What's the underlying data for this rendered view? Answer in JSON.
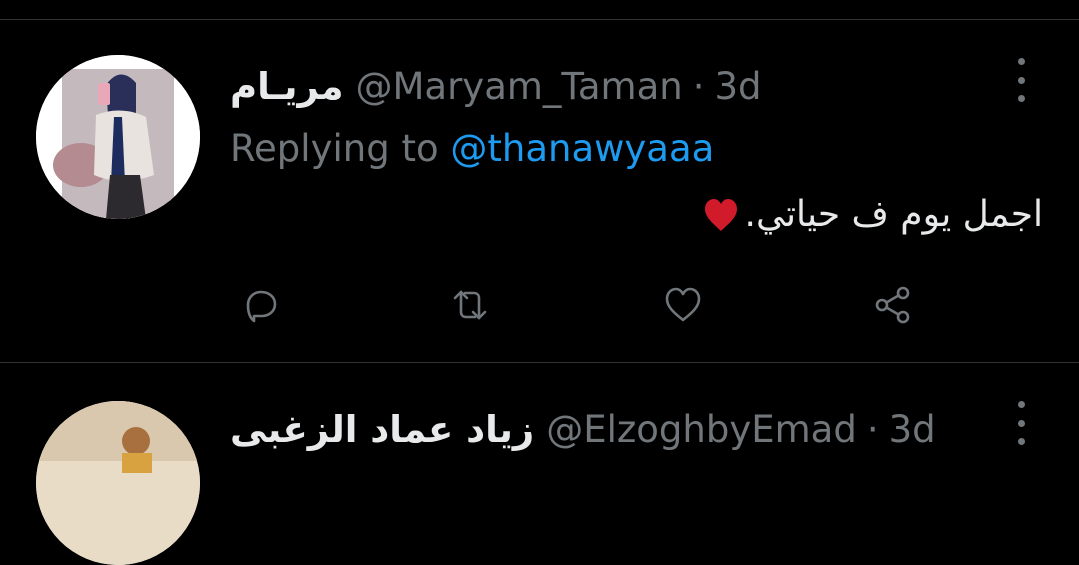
{
  "colors": {
    "background": "#000000",
    "divider": "#2f3336",
    "primary_text": "#e7e9ea",
    "secondary_text": "#71767b",
    "link": "#1d9bf0",
    "heart": "#d11a2a"
  },
  "tweets": [
    {
      "display_name": "مريـام",
      "handle": "@Maryam_Taman",
      "separator": "·",
      "time": "3d",
      "replying_prefix": "Replying to",
      "replying_handle": "@thanawyaaa",
      "text": "اجمل يوم ف حياتي.",
      "emoji": "heart-emoji",
      "actions": [
        "reply-icon",
        "retweet-icon",
        "like-icon",
        "share-icon"
      ]
    },
    {
      "display_name": "زياد عماد الزغبى",
      "handle": "@ElzoghbyEmad",
      "separator": "·",
      "time": "3d"
    }
  ]
}
